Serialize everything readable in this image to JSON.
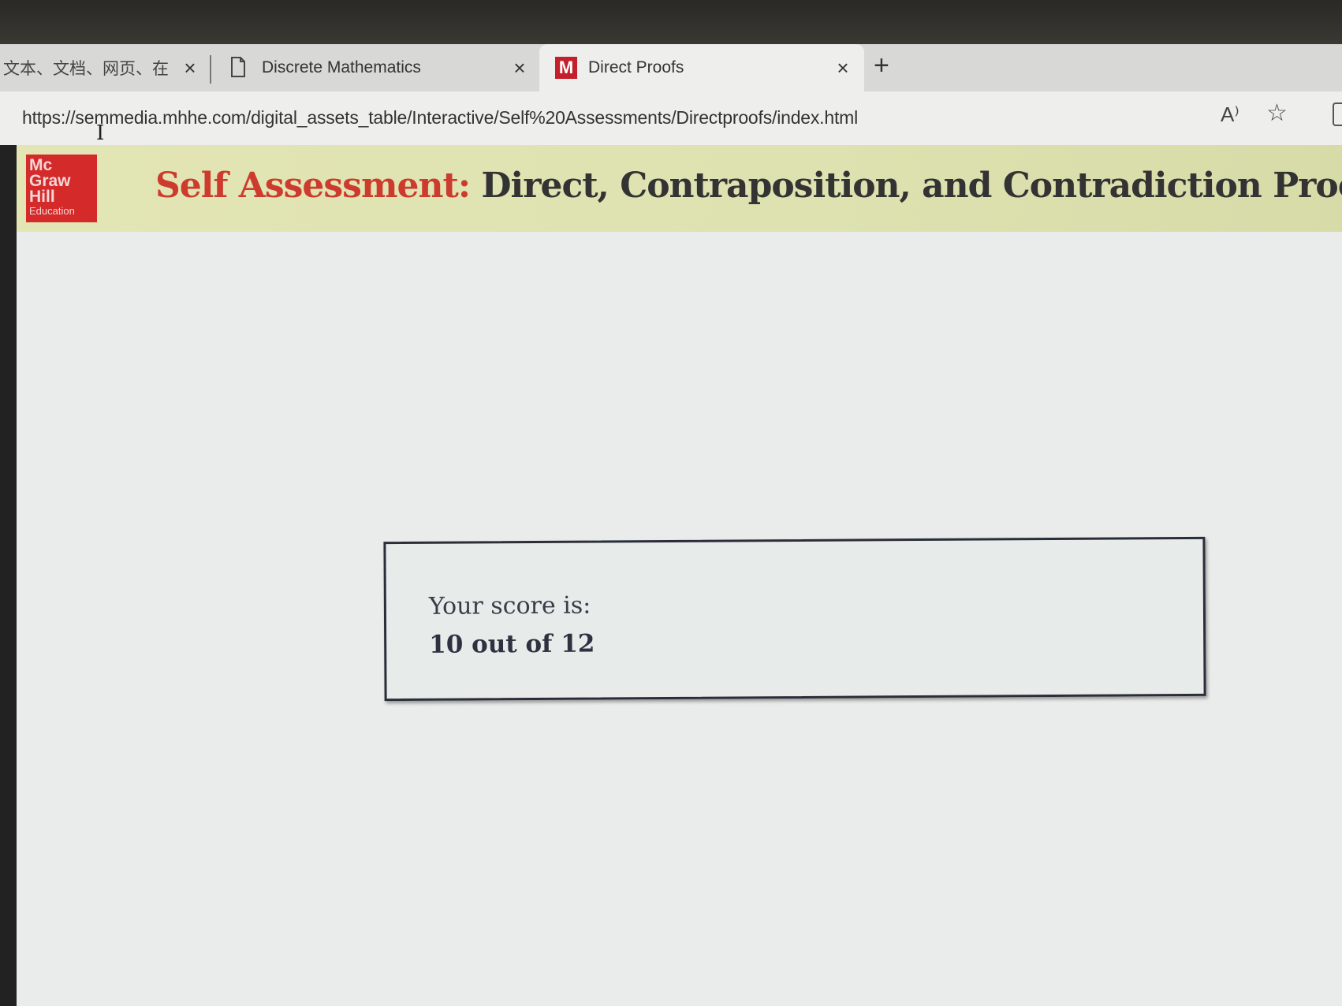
{
  "browser": {
    "tabs": [
      {
        "label": "文本、文档、网页、在",
        "close": "×"
      },
      {
        "label": "Discrete Mathematics",
        "close": "×"
      },
      {
        "label": "Direct Proofs",
        "close": "×",
        "favicon": "M",
        "active": true
      }
    ],
    "new_tab": "+",
    "url": "https://semmedia.mhhe.com/digital_assets_table/Interactive/Self%20Assessments/Directproofs/index.html",
    "read_aloud": "A⁾",
    "favorite": "☆"
  },
  "page": {
    "logo": {
      "line1": "Mc",
      "line2": "Graw",
      "line3": "Hill",
      "line4": "Education"
    },
    "title_accent": "Self Assessment:",
    "title_rest": "Direct, Contraposition, and Contradiction Proofs",
    "score_label": "Your score is:",
    "score_value": "10 out of 12"
  },
  "colors": {
    "brand_red": "#cc3b2e",
    "banner": "#e0e4b2"
  }
}
